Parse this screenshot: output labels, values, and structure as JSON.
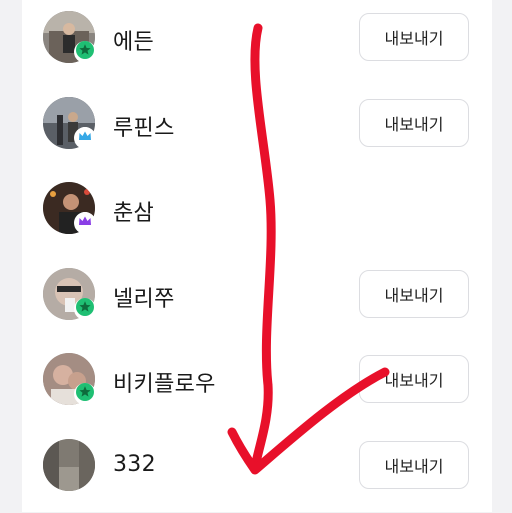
{
  "colors": {
    "page_background": "#f2f2f4",
    "panel_background": "#ffffff",
    "button_border": "#dcdde1",
    "arrow": "#e8102a",
    "badge_green": "#1fbf73",
    "badge_blue": "#36a8e6",
    "badge_purple": "#8a3ee6"
  },
  "members": [
    {
      "name": "에든",
      "badge": "green-star-icon",
      "action_label": "내보내기",
      "show_action": true
    },
    {
      "name": "루핀스",
      "badge": "blue-crown-icon",
      "action_label": "내보내기",
      "show_action": true
    },
    {
      "name": "춘삼",
      "badge": "purple-crown-icon",
      "action_label": "",
      "show_action": false
    },
    {
      "name": "넬리쭈",
      "badge": "green-star-icon",
      "action_label": "내보내기",
      "show_action": true
    },
    {
      "name": "비키플로우",
      "badge": "green-star-icon",
      "action_label": "내보내기",
      "show_action": true
    },
    {
      "name": "332",
      "badge": "",
      "action_label": "내보내기",
      "show_action": true
    }
  ],
  "annotation": {
    "icon": "red-arrow-down-icon"
  }
}
